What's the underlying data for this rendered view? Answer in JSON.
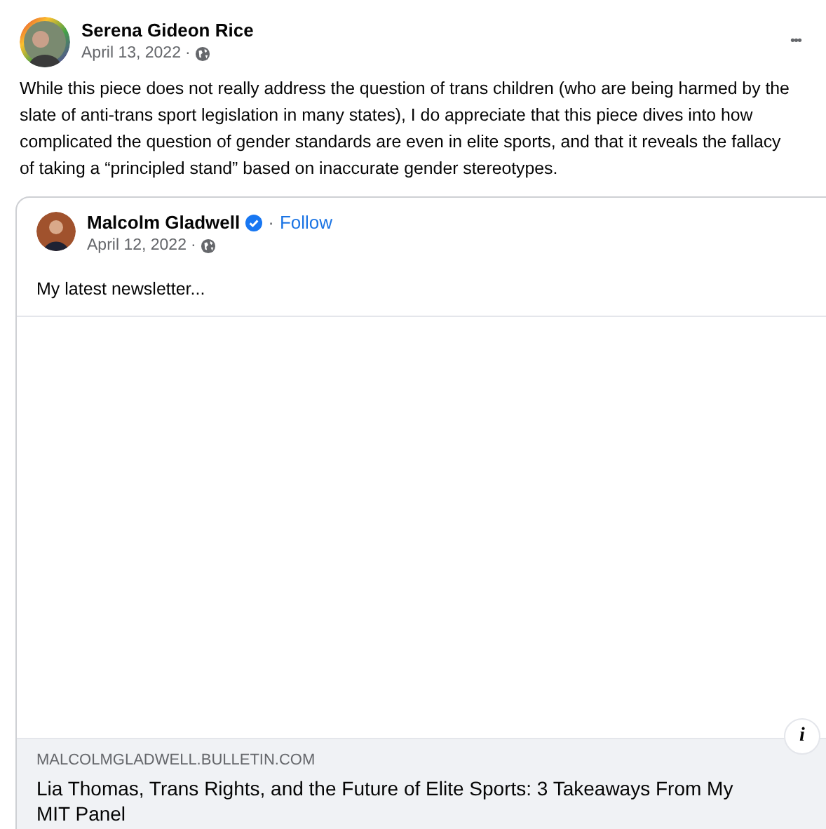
{
  "post": {
    "author": "Serena Gideon Rice",
    "date": "April 13, 2022",
    "separator": "·",
    "more": "•••",
    "text": "While this piece does not really address the question of trans children (who are being harmed by the slate of anti-trans sport legislation in many states), I do appreciate that this piece dives into how complicated the question of gender standards are even in elite sports, and that it reveals the fallacy of taking a “principled stand” based on inaccurate gender stereotypes."
  },
  "shared_post": {
    "author": "Malcolm Gladwell",
    "verified": true,
    "separator": "·",
    "follow": "Follow",
    "date": "April 12, 2022",
    "date_separator": "·",
    "text": "My latest newsletter...",
    "link": {
      "domain": "MALCOLMGLADWELL.BULLETIN.COM",
      "title": "Lia Thomas, Trans Rights, and the Future of Elite Sports: 3 Takeaways From My MIT Panel",
      "info": "i"
    }
  }
}
